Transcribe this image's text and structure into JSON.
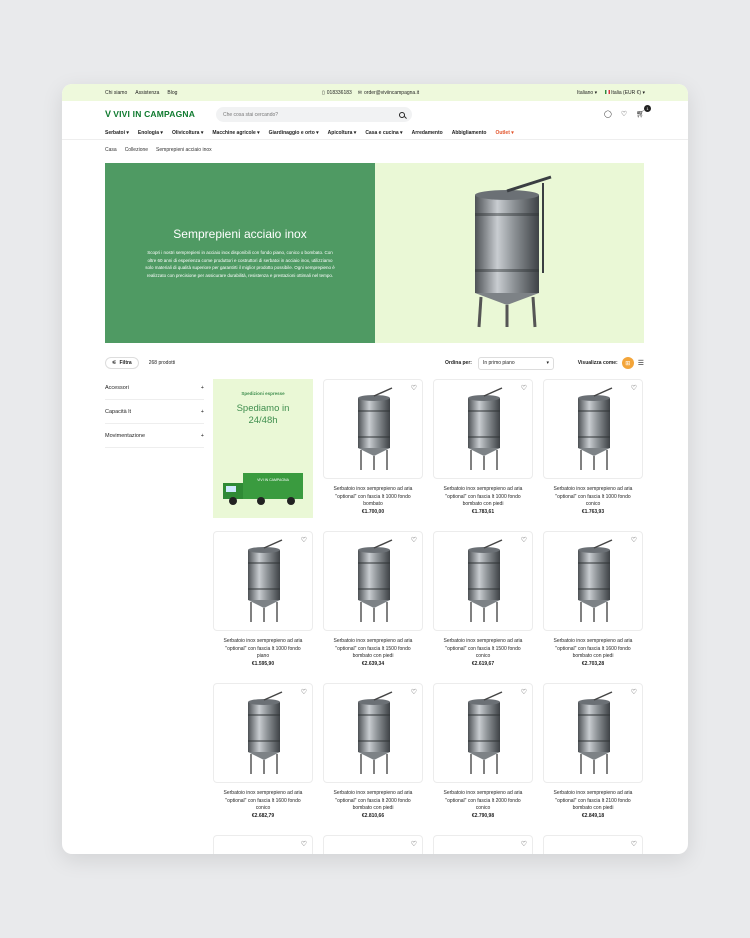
{
  "topbar": {
    "links": [
      "Chi siamo",
      "Assistenza",
      "Blog"
    ],
    "phone": "018336183",
    "email": "order@viviincampagna.it",
    "language": "Italiano",
    "currency": "Italia (EUR €)"
  },
  "header": {
    "logo_text": "VIVI IN CAMPAGNA",
    "search_placeholder": "Che cosa stai cercando?",
    "cart_count": "1"
  },
  "nav": {
    "items": [
      "Serbatoi",
      "Enologia",
      "Olivicoltura",
      "Macchine agricole",
      "Giardinaggio e orto",
      "Apicoltura",
      "Casa e cucina",
      "Arredamento",
      "Abbigliamento",
      "Outlet"
    ]
  },
  "breadcrumb": [
    "Casa",
    "Collezione",
    "Semprepieni acciaio inox"
  ],
  "hero": {
    "title": "Semprepieni acciaio inox",
    "description": "Scopri i nostri semprepieni in acciaio inox disponibili con fondo piano, conico o bombato. Con oltre 60 anni di esperienza come produttori e costruttori di serbatoi in acciaio inox, utilizziamo solo materiali di qualità superiore per garantirti il miglior prodotto possibile. Ogni semprepieno è realizzato con precisione per assicurare durabilità, resistenza e prestazioni ottimali nel tempo."
  },
  "toolbar": {
    "filter_label": "Filtra",
    "product_count": "268 prodotti",
    "sort_label": "Ordina per:",
    "sort_value": "In primo piano",
    "view_label": "Visualizza come:"
  },
  "filters": [
    "Accessori",
    "Capacità lt",
    "Movimentazione"
  ],
  "promo": {
    "tag": "Spedizioni espresse",
    "headline_1": "Spediamo in",
    "headline_2": "24/48h",
    "truck_text": "VIVI IN CAMPAGNA"
  },
  "products": [
    {
      "title_1": "Serbatoio inox semprepieno ad aria",
      "title_2": "\"optional\" con fascia lt 1000 fondo",
      "title_3": "bombato",
      "price": "€1.700,00"
    },
    {
      "title_1": "Serbatoio inox semprepieno ad aria",
      "title_2": "\"optional\" con fascia lt 1000 fondo",
      "title_3": "bombato con piedi",
      "price": "€1.783,61"
    },
    {
      "title_1": "Serbatoio inox semprepieno ad aria",
      "title_2": "\"optional\" con fascia lt 1000 fondo",
      "title_3": "conico",
      "price": "€1.763,93"
    },
    {
      "title_1": "Serbatoio inox semprepieno ad aria",
      "title_2": "\"optional\" con fascia lt 1000 fondo",
      "title_3": "piano",
      "price": "€1.595,90"
    },
    {
      "title_1": "Serbatoio inox semprepieno ad aria",
      "title_2": "\"optional\" con fascia lt 1500 fondo",
      "title_3": "bombato con piedi",
      "price": "€2.639,34"
    },
    {
      "title_1": "Serbatoio inox semprepieno ad aria",
      "title_2": "\"optional\" con fascia lt 1500 fondo",
      "title_3": "conico",
      "price": "€2.619,67"
    },
    {
      "title_1": "Serbatoio inox semprepieno ad aria",
      "title_2": "\"optional\" con fascia lt 1600 fondo",
      "title_3": "bombato con piedi",
      "price": "€2.703,28"
    },
    {
      "title_1": "Serbatoio inox semprepieno ad aria",
      "title_2": "\"optional\" con fascia lt 1600 fondo",
      "title_3": "conico",
      "price": "€2.682,79"
    },
    {
      "title_1": "Serbatoio inox semprepieno ad aria",
      "title_2": "\"optional\" con fascia lt 2000 fondo",
      "title_3": "bombato con piedi",
      "price": "€2.810,66"
    },
    {
      "title_1": "Serbatoio inox semprepieno ad aria",
      "title_2": "\"optional\" con fascia lt 2000 fondo",
      "title_3": "conico",
      "price": "€2.790,98"
    },
    {
      "title_1": "Serbatoio inox semprepieno ad aria",
      "title_2": "\"optional\" con fascia lt 2100 fondo",
      "title_3": "bombato con piedi",
      "price": "€2.849,18"
    }
  ],
  "colors": {
    "brand_green": "#0f7a2f",
    "hero_green": "#4f9a63",
    "light_green": "#eaf8d6",
    "outlet": "#e2542b",
    "view_toggle": "#f3a53a"
  }
}
